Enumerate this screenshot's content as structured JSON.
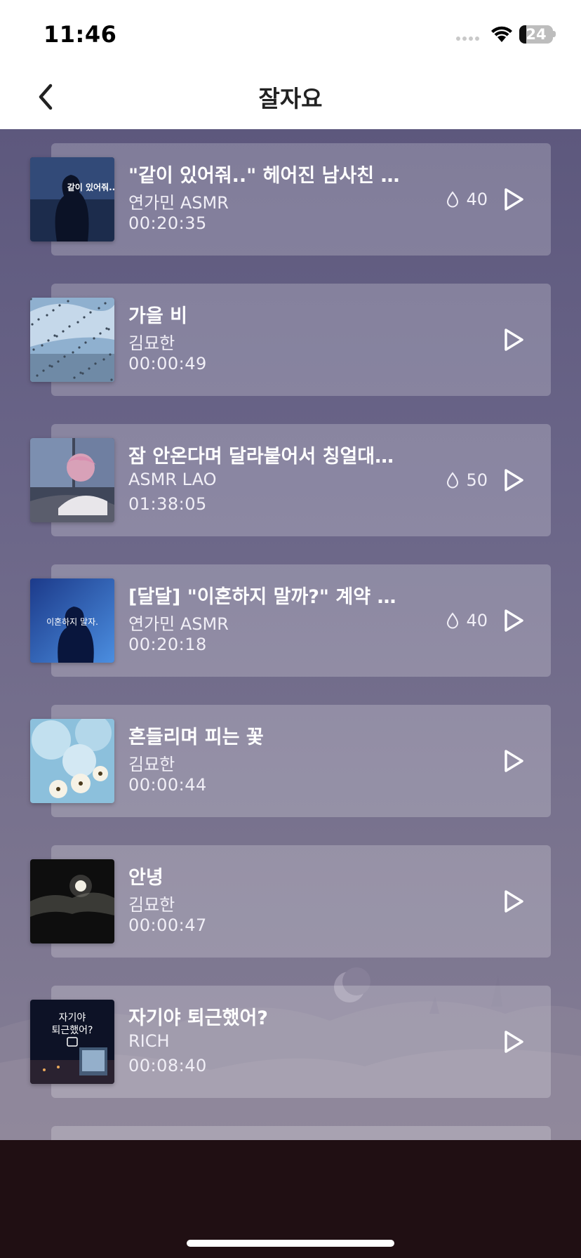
{
  "status_bar": {
    "time": "11:46",
    "battery": "24"
  },
  "nav": {
    "title": "잘자요"
  },
  "tracks": [
    {
      "title": "\"같이 있어줘..\" 헤어진 남사친 위...",
      "artist": "연가민 ASMR",
      "duration": "00:20:35",
      "drops": "40",
      "thumb_text": "같이 있어줘.."
    },
    {
      "title": "가을 비",
      "artist": "김묘한",
      "duration": "00:00:49"
    },
    {
      "title": "잠 안온다며 달라붙어서 칭얼대다가 갑...",
      "artist": "ASMR LAO",
      "duration": "01:38:05",
      "drops": "50"
    },
    {
      "title": "[달달] \"이혼하지 말까?\" 계약 결...",
      "artist": "연가민 ASMR",
      "duration": "00:20:18",
      "drops": "40",
      "thumb_text": "이혼하지 말자."
    },
    {
      "title": "흔들리며 피는 꽃",
      "artist": "김묘한",
      "duration": "00:00:44"
    },
    {
      "title": "안녕",
      "artist": "김묘한",
      "duration": "00:00:47"
    },
    {
      "title": "자기야 퇴근했어?",
      "artist": "RICH",
      "duration": "00:08:40",
      "thumb_text_1": "자기야",
      "thumb_text_2": "퇴근했어?"
    }
  ]
}
